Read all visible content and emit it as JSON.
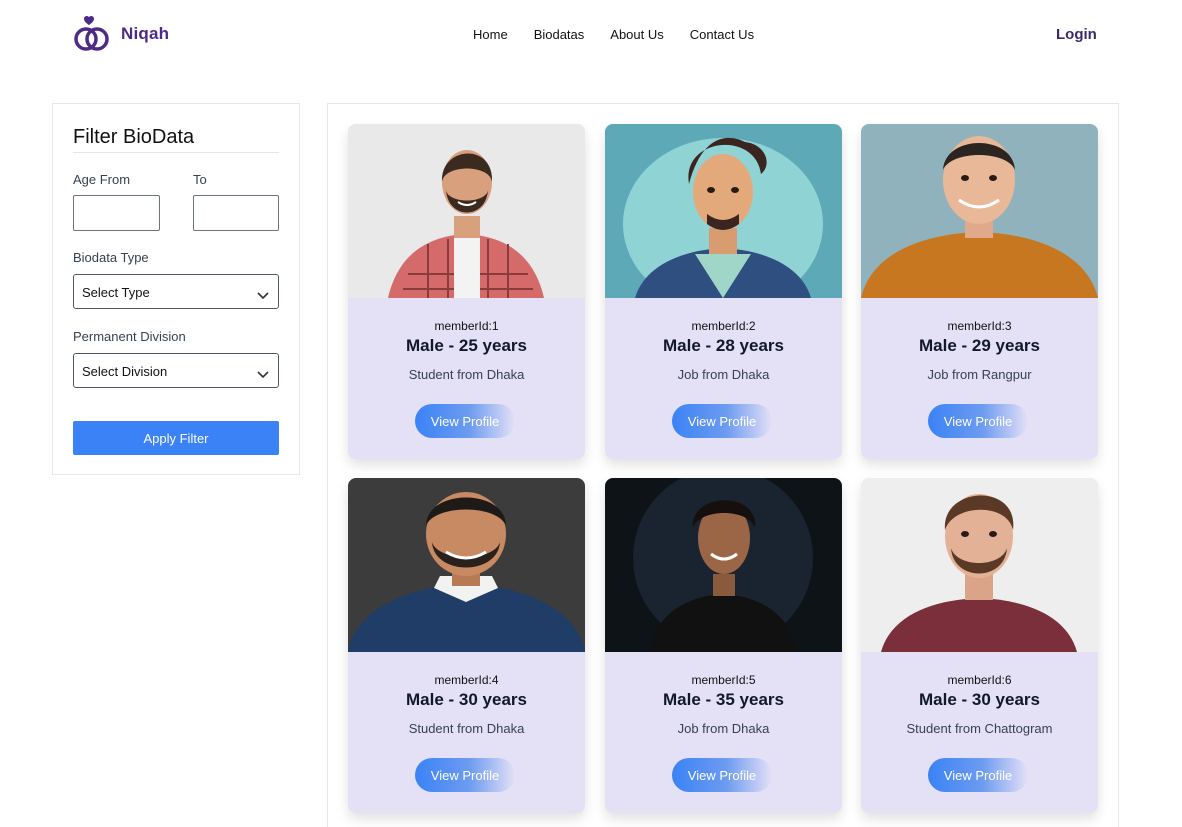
{
  "brand": {
    "name": "Niqah",
    "accent": "#4c2a85"
  },
  "nav": {
    "links": [
      "Home",
      "Biodatas",
      "About Us",
      "Contact Us"
    ],
    "login": "Login"
  },
  "filter": {
    "title": "Filter BioData",
    "age_from_label": "Age From",
    "age_to_label": "To",
    "age_from_value": "",
    "age_to_value": "",
    "type_label": "Biodata Type",
    "type_value": "Select Type",
    "division_label": "Permanent Division",
    "division_value": "Select Division",
    "apply": "Apply Filter"
  },
  "colors": {
    "apply_button": "#3b82f6",
    "card_bg": "#e4e0f6"
  },
  "biodatas": [
    {
      "member_id": "memberId:1",
      "title": "Male - 25 years",
      "subtitle": "Student from Dhaka",
      "button": "View Profile",
      "photo": "man-in-plaid-shirt-photo"
    },
    {
      "member_id": "memberId:2",
      "title": "Male - 28 years",
      "subtitle": "Job from Dhaka",
      "button": "View Profile",
      "photo": "cartoon-man-avatar"
    },
    {
      "member_id": "memberId:3",
      "title": "Male - 29 years",
      "subtitle": "Job from Rangpur",
      "button": "View Profile",
      "photo": "man-in-orange-sweater-photo"
    },
    {
      "member_id": "memberId:4",
      "title": "Male - 30 years",
      "subtitle": "Student from Dhaka",
      "button": "View Profile",
      "photo": "man-in-navy-sweater-photo"
    },
    {
      "member_id": "memberId:5",
      "title": "Male - 35 years",
      "subtitle": "Job from Dhaka",
      "button": "View Profile",
      "photo": "man-in-black-tshirt-photo"
    },
    {
      "member_id": "memberId:6",
      "title": "Male - 30 years",
      "subtitle": "Student from Chattogram",
      "button": "View Profile",
      "photo": "man-in-maroon-tshirt-photo"
    }
  ]
}
